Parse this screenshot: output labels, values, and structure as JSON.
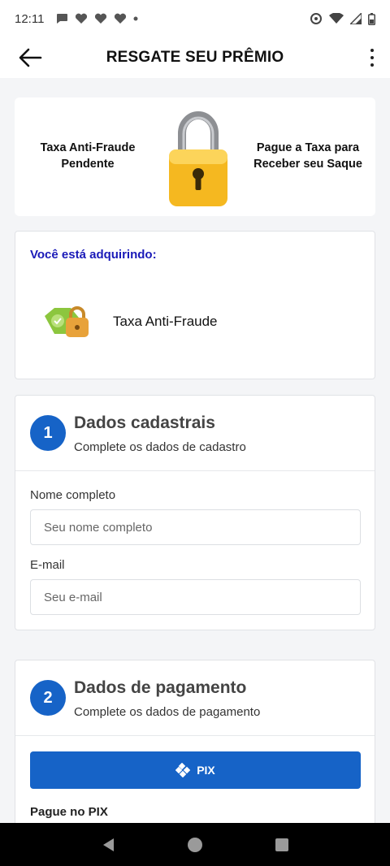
{
  "status_bar": {
    "time": "12:11"
  },
  "header": {
    "title": "RESGATE SEU PRÊMIO"
  },
  "banner": {
    "left_text": "Taxa Anti-Fraude Pendente",
    "right_text": "Pague a Taxa para Receber seu Saque"
  },
  "purchase": {
    "label": "Você está adquirindo:",
    "product_name": "Taxa Anti-Fraude"
  },
  "step1": {
    "number": "1",
    "title": "Dados cadastrais",
    "subtitle": "Complete os dados de cadastro",
    "name_label": "Nome completo",
    "name_placeholder": "Seu nome completo",
    "email_label": "E-mail",
    "email_placeholder": "Seu e-mail"
  },
  "step2": {
    "number": "2",
    "title": "Dados de pagamento",
    "subtitle": "Complete os dados de pagamento",
    "pix_label": "PIX",
    "pay_label": "Pague no PIX"
  },
  "colors": {
    "primary": "#1663c7",
    "purchase_label": "#1a1ab8",
    "lock_body": "#f5b820"
  },
  "icons": [
    "back-arrow-icon",
    "more-vertical-icon",
    "padlock-icon",
    "pix-icon"
  ]
}
